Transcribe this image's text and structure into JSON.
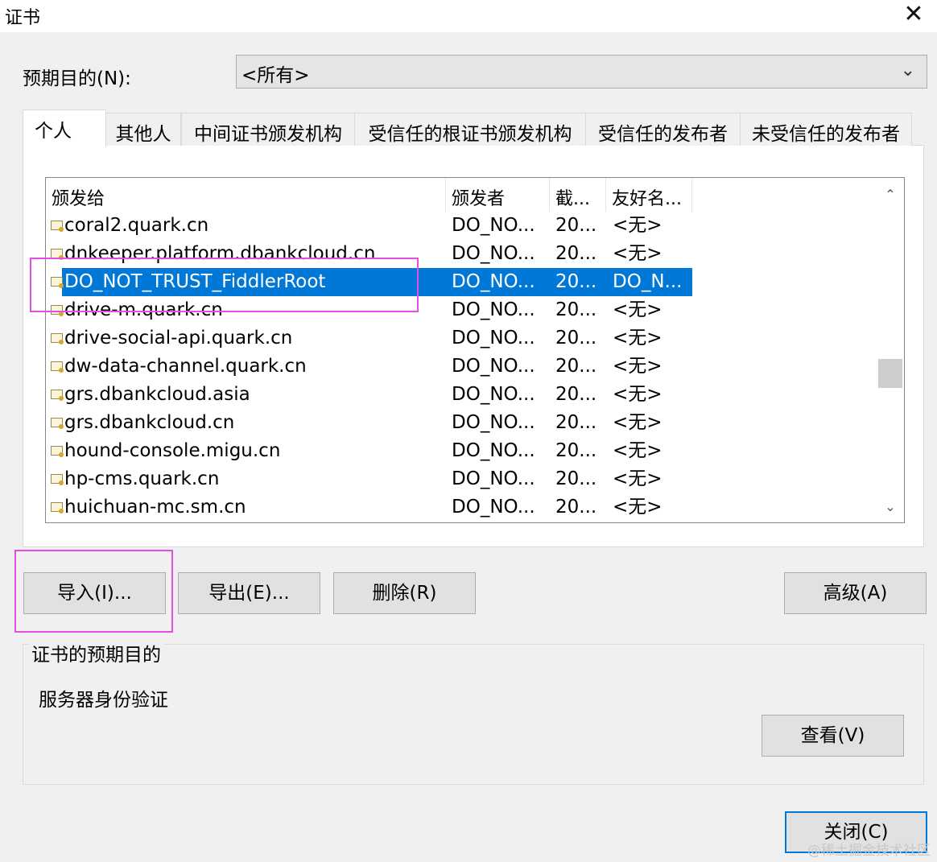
{
  "window": {
    "title": "证书",
    "close_glyph": "✕"
  },
  "purpose": {
    "label": "预期目的(N):",
    "selected": "<所有>"
  },
  "tabs": [
    {
      "label": "个人"
    },
    {
      "label": "其他人"
    },
    {
      "label": "中间证书颁发机构"
    },
    {
      "label": "受信任的根证书颁发机构"
    },
    {
      "label": "受信任的发布者"
    },
    {
      "label": "未受信任的发布者"
    }
  ],
  "list": {
    "columns": [
      "颁发给",
      "颁发者",
      "截...",
      "友好名..."
    ],
    "rows": [
      {
        "issued_to": "coral2.quark.cn",
        "issuer": "DO_NO...",
        "expires": "20...",
        "friendly": "<无>"
      },
      {
        "issued_to": "dnkeeper.platform.dbankcloud.cn",
        "issuer": "DO_NO...",
        "expires": "20...",
        "friendly": "<无>"
      },
      {
        "issued_to": "DO_NOT_TRUST_FiddlerRoot",
        "issuer": "DO_NO...",
        "expires": "20...",
        "friendly": "DO_N..."
      },
      {
        "issued_to": "drive-m.quark.cn",
        "issuer": "DO_NO...",
        "expires": "20...",
        "friendly": "<无>"
      },
      {
        "issued_to": "drive-social-api.quark.cn",
        "issuer": "DO_NO...",
        "expires": "20...",
        "friendly": "<无>"
      },
      {
        "issued_to": "dw-data-channel.quark.cn",
        "issuer": "DO_NO...",
        "expires": "20...",
        "friendly": "<无>"
      },
      {
        "issued_to": "grs.dbankcloud.asia",
        "issuer": "DO_NO...",
        "expires": "20...",
        "friendly": "<无>"
      },
      {
        "issued_to": "grs.dbankcloud.cn",
        "issuer": "DO_NO...",
        "expires": "20...",
        "friendly": "<无>"
      },
      {
        "issued_to": "hound-console.migu.cn",
        "issuer": "DO_NO...",
        "expires": "20...",
        "friendly": "<无>"
      },
      {
        "issued_to": "hp-cms.quark.cn",
        "issuer": "DO_NO...",
        "expires": "20...",
        "friendly": "<无>"
      },
      {
        "issued_to": "huichuan-mc.sm.cn",
        "issuer": "DO_NO...",
        "expires": "20...",
        "friendly": "<无>"
      }
    ]
  },
  "buttons": {
    "import": "导入(I)...",
    "export": "导出(E)...",
    "delete": "删除(R)",
    "advanced": "高级(A)",
    "view": "查看(V)",
    "close": "关闭(C)"
  },
  "purpose_group": {
    "title": "证书的预期目的",
    "value": "服务器身份验证"
  },
  "watermark": "@稀土掘金技术社区",
  "colors": {
    "selection": "#0078d7",
    "highlight_box": "#e54ee5"
  }
}
